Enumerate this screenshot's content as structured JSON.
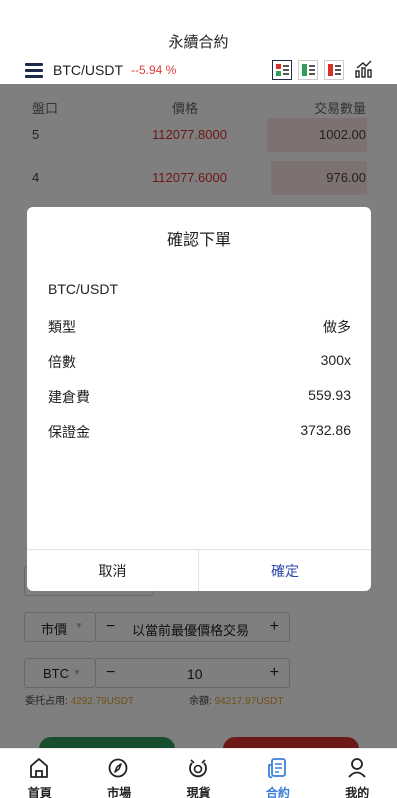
{
  "header": {
    "title": "永續合約",
    "pair": "BTC/USDT",
    "change": "--5.94 %"
  },
  "book": {
    "headers": {
      "level": "盤口",
      "price": "價格",
      "qty": "交易數量"
    },
    "rows": [
      {
        "level": "5",
        "price": "112077.8000",
        "qty": "1002.00"
      },
      {
        "level": "4",
        "price": "112077.6000",
        "qty": "976.00"
      }
    ]
  },
  "form": {
    "order_type": "市價",
    "market_hint": "以當前最優價格交易",
    "minus": "−",
    "plus": "+",
    "unit": "BTC",
    "amount": "10",
    "entrust_label": "委托占用:",
    "entrust_value": "4292.79USDT",
    "balance_label": "余額:",
    "balance_value": "94217.97USDT"
  },
  "modal": {
    "title": "確認下單",
    "symbol": "BTC/USDT",
    "rows": [
      {
        "key": "類型",
        "value": "做多"
      },
      {
        "key": "倍數",
        "value": "300x"
      },
      {
        "key": "建倉費",
        "value": "559.93"
      },
      {
        "key": "保證金",
        "value": "3732.86"
      }
    ],
    "cancel": "取消",
    "confirm": "確定"
  },
  "nav": [
    {
      "label": "首頁",
      "icon": "home-icon"
    },
    {
      "label": "市場",
      "icon": "compass-icon"
    },
    {
      "label": "現貨",
      "icon": "spot-icon"
    },
    {
      "label": "合約",
      "icon": "contract-icon",
      "active": true
    },
    {
      "label": "我的",
      "icon": "user-icon"
    }
  ],
  "colors": {
    "up": "#2e9d5a",
    "down": "#d9302c",
    "accent": "#3b7fd9",
    "confirm": "#2b49a8"
  }
}
